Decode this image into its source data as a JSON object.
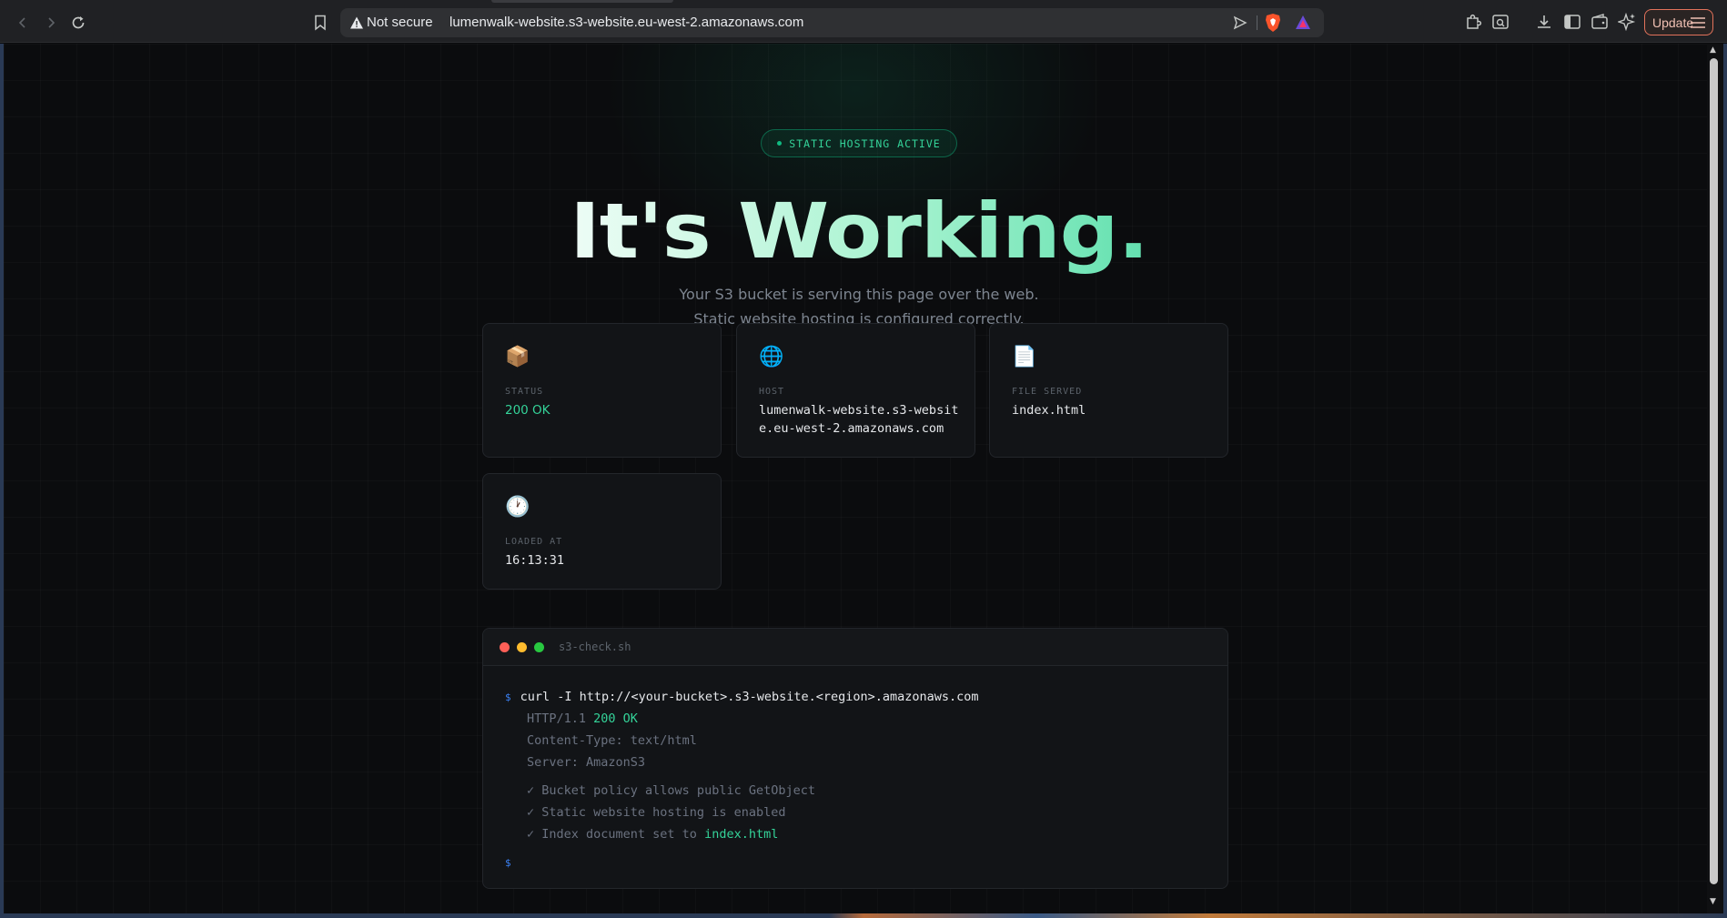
{
  "browser": {
    "security_label": "Not secure",
    "url": "lumenwalk-website.s3-website.eu-west-2.amazonaws.com",
    "update_label": "Update"
  },
  "page": {
    "badge": "STATIC HOSTING ACTIVE",
    "headline": "It's Working.",
    "subtitle": "Your S3 bucket is serving this page over the web. Static website hosting is configured correctly.",
    "cards": [
      {
        "icon": "📦",
        "label": "STATUS",
        "value": "200 OK"
      },
      {
        "icon": "🌐",
        "label": "HOST",
        "value": "lumenwalk-website.s3-website.eu-west-2.amazonaws.com"
      },
      {
        "icon": "📄",
        "label": "FILE SERVED",
        "value": "index.html"
      },
      {
        "icon": "🕐",
        "label": "LOADED AT",
        "value": "16:13:31"
      }
    ],
    "terminal": {
      "title": "s3-check.sh",
      "prompt": "$",
      "command": "curl -I http://<your-bucket>.s3-website.<region>.amazonaws.com",
      "http_prefix": "HTTP/1.1 ",
      "http_status": "200 OK",
      "content_type": "Content-Type: text/html",
      "server": "Server: AmazonS3",
      "check_1": "✓ Bucket policy allows public GetObject",
      "check_2": "✓ Static website hosting is enabled",
      "check_3_prefix": "✓ Index document set to ",
      "check_3_file": "index.html"
    }
  },
  "colors": {
    "accent": "#34d399",
    "prompt": "#3b82f6",
    "dot_red": "#ff5f57",
    "dot_yellow": "#febc2e",
    "dot_green": "#28c840"
  }
}
